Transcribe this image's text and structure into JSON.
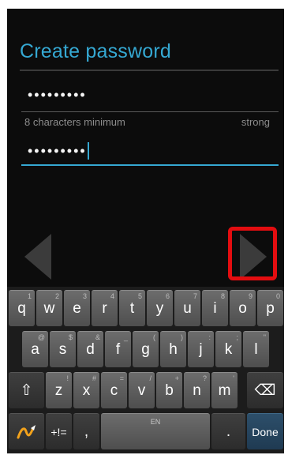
{
  "title": "Create password",
  "password_field": {
    "masked_value": "•••••••••"
  },
  "confirm_field": {
    "masked_value": "•••••••••"
  },
  "hint": "8 characters minimum",
  "strength": "strong",
  "keyboard": {
    "row1": [
      {
        "label": "q",
        "sub": "1"
      },
      {
        "label": "w",
        "sub": "2"
      },
      {
        "label": "e",
        "sub": "3"
      },
      {
        "label": "r",
        "sub": "4"
      },
      {
        "label": "t",
        "sub": "5"
      },
      {
        "label": "y",
        "sub": "6"
      },
      {
        "label": "u",
        "sub": "7"
      },
      {
        "label": "i",
        "sub": "8"
      },
      {
        "label": "o",
        "sub": "9"
      },
      {
        "label": "p",
        "sub": "0"
      }
    ],
    "row2": [
      {
        "label": "a",
        "sub": "@"
      },
      {
        "label": "s",
        "sub": "$"
      },
      {
        "label": "d",
        "sub": "&"
      },
      {
        "label": "f",
        "sub": "_"
      },
      {
        "label": "g",
        "sub": "("
      },
      {
        "label": "h",
        "sub": ")"
      },
      {
        "label": "j",
        "sub": ":"
      },
      {
        "label": "k",
        "sub": ";"
      },
      {
        "label": "l",
        "sub": "\""
      }
    ],
    "row3": [
      {
        "label": "z",
        "sub": "!"
      },
      {
        "label": "x",
        "sub": "#"
      },
      {
        "label": "c",
        "sub": "="
      },
      {
        "label": "v",
        "sub": "/"
      },
      {
        "label": "b",
        "sub": "+"
      },
      {
        "label": "n",
        "sub": "?"
      },
      {
        "label": "m",
        "sub": "'"
      }
    ],
    "shift_symbol": "⇧",
    "backspace_symbol": "⌫",
    "symbols_label": "+!=",
    "comma_label": ",",
    "space_label": "EN",
    "period_label": ".",
    "done_label": "Done"
  }
}
